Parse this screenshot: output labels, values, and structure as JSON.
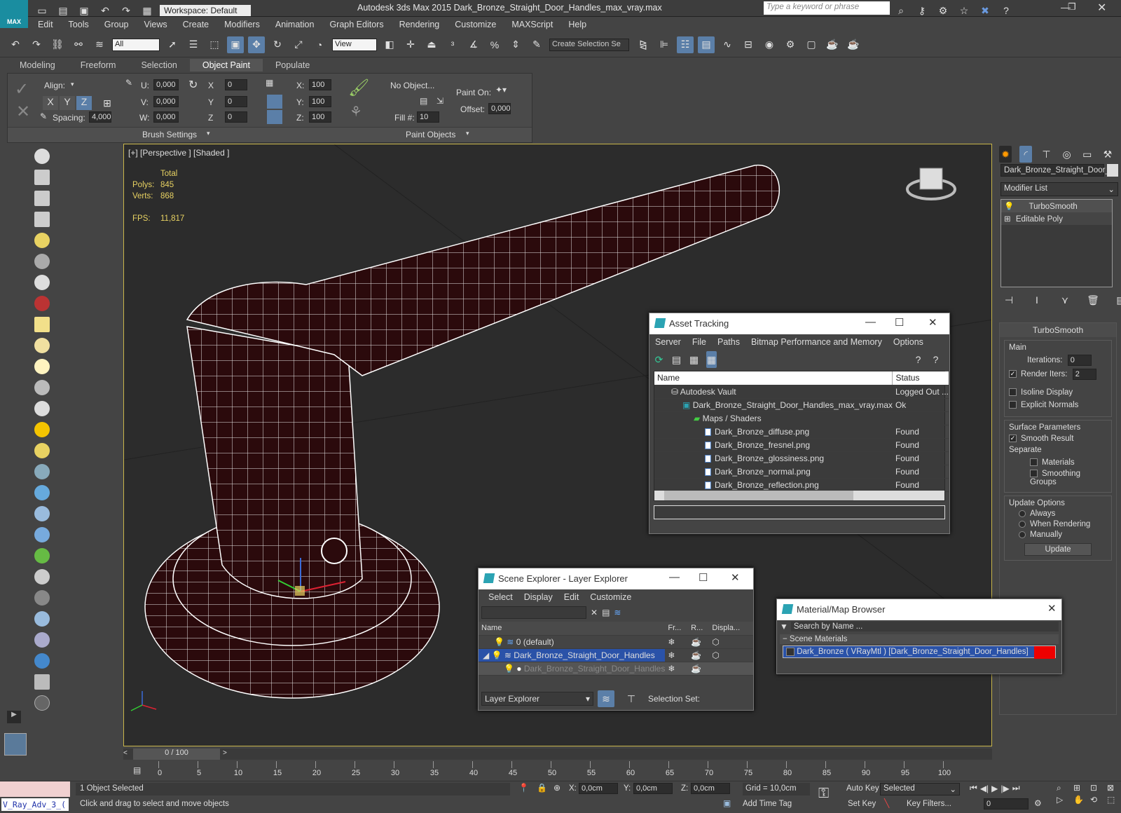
{
  "app": {
    "title": "Autodesk 3ds Max  2015    Dark_Bronze_Straight_Door_Handles_max_vray.max",
    "workspace": "Workspace: Default",
    "search_placeholder": "Type a keyword or phrase",
    "logo": "MAX"
  },
  "menu": [
    "Edit",
    "Tools",
    "Group",
    "Views",
    "Create",
    "Modifiers",
    "Animation",
    "Graph Editors",
    "Rendering",
    "Customize",
    "MAXScript",
    "Help"
  ],
  "toolbar": {
    "filter": "All",
    "refcoord": "View",
    "selset": "Create Selection Se"
  },
  "ribbon": {
    "tabs": [
      "Modeling",
      "Freeform",
      "Selection",
      "Object Paint",
      "Populate"
    ],
    "active_tab": "Object Paint",
    "align_label": "Align:",
    "axes": [
      "X",
      "Y",
      "Z"
    ],
    "spacing_label": "Spacing:",
    "spacing_value": "4,000",
    "u_label": "U:",
    "u_value": "0,000",
    "v_label": "V:",
    "v_value": "0,000",
    "w_label": "W:",
    "w_value": "0,000",
    "x_label": "X",
    "x_value": "0",
    "y_label": "Y",
    "y_value": "0",
    "z_label": "Z",
    "z_value": "0",
    "sx_label": "X:",
    "sx_value": "100",
    "sy_label": "Y:",
    "sy_value": "100",
    "sz_label": "Z:",
    "sz_value": "100",
    "no_object": "No Object...",
    "fill_label": "Fill #:",
    "fill_value": "10",
    "paint_on_label": "Paint On:",
    "offset_label": "Offset:",
    "offset_value": "0,000",
    "brush_settings": "Brush Settings",
    "paint_objects": "Paint Objects"
  },
  "viewport": {
    "label": "[+] [Perspective ] [Shaded ]",
    "total_label": "Total",
    "polys_label": "Polys:",
    "polys": "845",
    "verts_label": "Verts:",
    "verts": "868",
    "fps_label": "FPS:",
    "fps": "11,817"
  },
  "right_panel": {
    "object_name": "Dark_Bronze_Straight_Door_",
    "modifier_list": "Modifier List",
    "stack": [
      "TurboSmooth",
      "Editable Poly"
    ],
    "rollout_title": "TurboSmooth",
    "main_label": "Main",
    "iterations_label": "Iterations:",
    "iterations": "0",
    "render_iters_label": "Render Iters:",
    "render_iters": "2",
    "isoline": "Isoline Display",
    "explicit": "Explicit Normals",
    "surface_label": "Surface Parameters",
    "smooth_result": "Smooth Result",
    "separate_label": "Separate",
    "materials": "Materials",
    "smoothing_groups": "Smoothing Groups",
    "update_label": "Update Options",
    "always": "Always",
    "when_rendering": "When Rendering",
    "manually": "Manually",
    "update_button": "Update"
  },
  "asset_tracking": {
    "title": "Asset Tracking",
    "menu": [
      "Server",
      "File",
      "Paths",
      "Bitmap Performance and Memory",
      "Options"
    ],
    "col_name": "Name",
    "col_status": "Status",
    "rows": [
      {
        "name": "Autodesk Vault",
        "status": "Logged Out ..."
      },
      {
        "name": "Dark_Bronze_Straight_Door_Handles_max_vray.max",
        "status": "Ok"
      },
      {
        "name": "Maps / Shaders",
        "status": ""
      },
      {
        "name": "Dark_Bronze_diffuse.png",
        "status": "Found"
      },
      {
        "name": "Dark_Bronze_fresnel.png",
        "status": "Found"
      },
      {
        "name": "Dark_Bronze_glossiness.png",
        "status": "Found"
      },
      {
        "name": "Dark_Bronze_normal.png",
        "status": "Found"
      },
      {
        "name": "Dark_Bronze_reflection.png",
        "status": "Found"
      }
    ]
  },
  "scene_explorer": {
    "title": "Scene Explorer - Layer Explorer",
    "menu": [
      "Select",
      "Display",
      "Edit",
      "Customize"
    ],
    "cols": [
      "Name",
      "Fr...",
      "R...",
      "Displa..."
    ],
    "rows": [
      "0 (default)",
      "Dark_Bronze_Straight_Door_Handles",
      "Dark_Bronze_Straight_Door_Handles"
    ],
    "footer_dropdown": "Layer Explorer",
    "selection_set": "Selection Set:"
  },
  "material_browser": {
    "title": "Material/Map Browser",
    "search_placeholder": "Search by Name ...",
    "group": "Scene Materials",
    "item": "Dark_Bronze  ( VRayMtl ) [Dark_Bronze_Straight_Door_Handles]"
  },
  "timeline": {
    "frame": "0 / 100",
    "ticks": [
      "0",
      "5",
      "10",
      "15",
      "20",
      "25",
      "30",
      "35",
      "40",
      "45",
      "50",
      "55",
      "60",
      "65",
      "70",
      "75",
      "80",
      "85",
      "90",
      "95",
      "100"
    ]
  },
  "status": {
    "script_name": "V_Ray_Adv_3_(",
    "selected": "1 Object Selected",
    "prompt": "Click and drag to select and move objects",
    "x_label": "X:",
    "x_value": "0,0cm",
    "y_label": "Y:",
    "y_value": "0,0cm",
    "z_label": "Z:",
    "z_value": "0,0cm",
    "grid": "Grid = 10,0cm",
    "add_time_tag": "Add Time Tag",
    "auto_key": "Auto Key",
    "set_key": "Set Key",
    "key_mode": "Selected",
    "key_filters": "Key Filters...",
    "frame_value": "0"
  },
  "colors": {
    "accent": "#5b7fa8",
    "viewport_border": "#c9b64a",
    "stats": "#e8d262",
    "selected_row": "#2a52a8"
  }
}
